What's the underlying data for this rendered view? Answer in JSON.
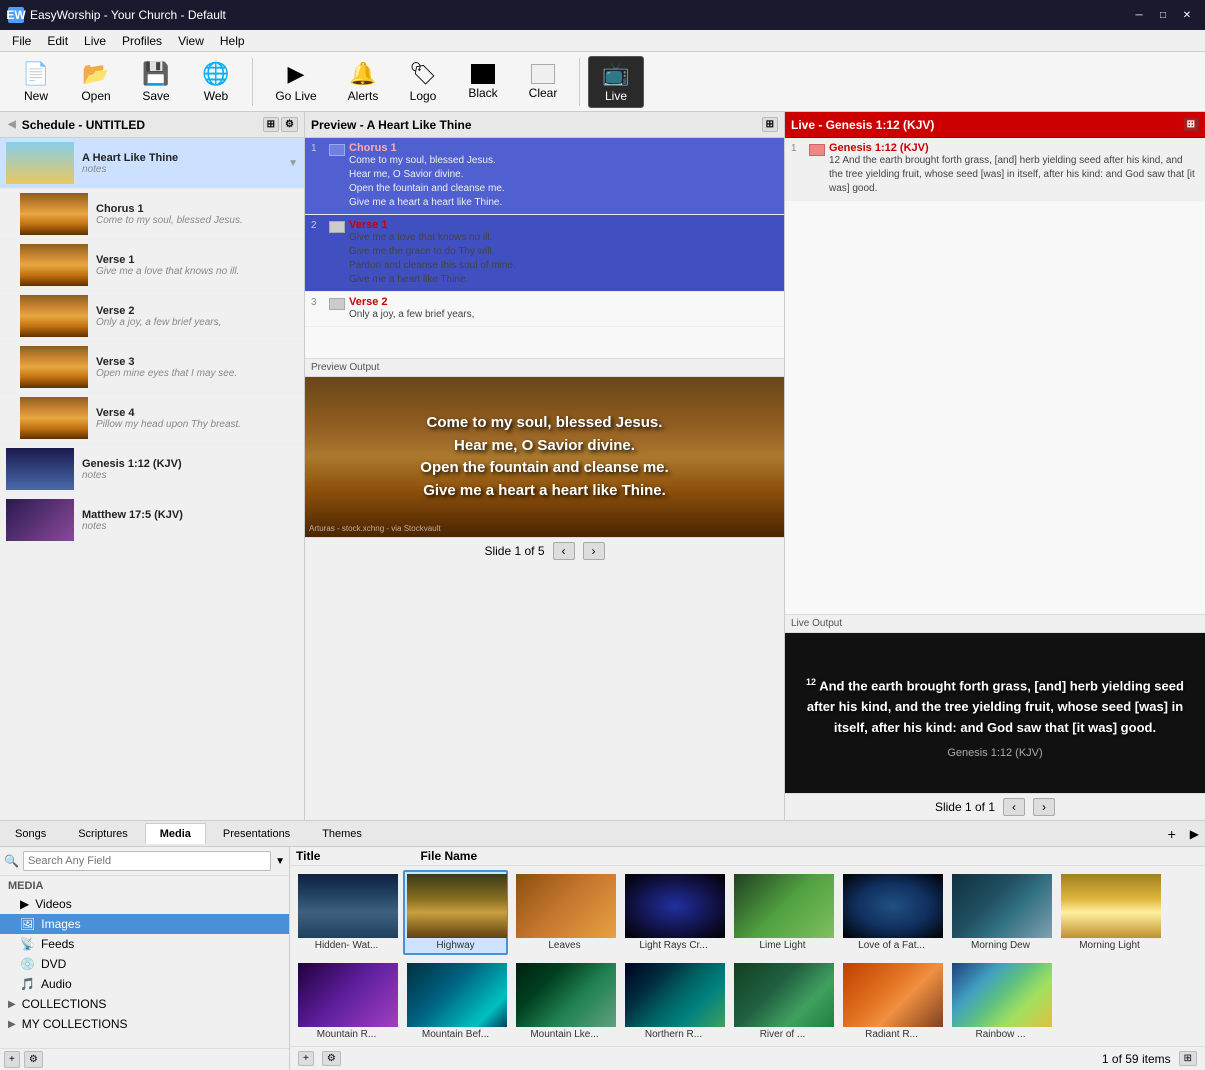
{
  "app": {
    "title": "EasyWorship - Your Church - Default",
    "icon": "EW"
  },
  "titlebar": {
    "minimize": "─",
    "maximize": "□",
    "close": "✕"
  },
  "menu": {
    "items": [
      "File",
      "Edit",
      "Live",
      "Profiles",
      "View",
      "Help"
    ]
  },
  "toolbar": {
    "new_label": "New",
    "open_label": "Open",
    "save_label": "Save",
    "web_label": "Web",
    "go_live_label": "Go Live",
    "alerts_label": "Alerts",
    "logo_label": "Logo",
    "black_label": "Black",
    "clear_label": "Clear",
    "live_label": "Live"
  },
  "schedule": {
    "title": "Schedule - UNTITLED",
    "items": [
      {
        "title": "A Heart Like Thine",
        "sub": "notes",
        "type": "active"
      },
      {
        "title": "Chorus 1",
        "sub": "Come to my soul, blessed Jesus.",
        "type": "song"
      },
      {
        "title": "Verse 1",
        "sub": "Give me a love that knows no ill.",
        "type": "song"
      },
      {
        "title": "Verse 2",
        "sub": "Only a joy, a few brief years,",
        "type": "song"
      },
      {
        "title": "Verse 3",
        "sub": "Open mine eyes that I may see.",
        "type": "song"
      },
      {
        "title": "Verse 4",
        "sub": "Pillow my head upon Thy breast.",
        "type": "song"
      },
      {
        "title": "Genesis 1:12 (KJV)",
        "sub": "notes",
        "type": "scripture"
      },
      {
        "title": "Matthew 17:5 (KJV)",
        "sub": "notes",
        "type": "scripture"
      }
    ]
  },
  "preview_panel": {
    "title": "Preview - A Heart Like Thine",
    "slides": [
      {
        "num": 1,
        "label": "Chorus 1",
        "lines": [
          "Come to my soul, blessed Jesus.",
          "Hear me, O Savior divine.",
          "Open the fountain and cleanse me.",
          "Give me a heart a heart like Thine."
        ]
      },
      {
        "num": 2,
        "label": "Verse 1",
        "lines": [
          "Give me a love that knows no ill.",
          "Give me the grace to do Thy will.",
          "Pardon and cleanse this soul of mine.",
          "Give me a heart like Thine."
        ]
      },
      {
        "num": 3,
        "label": "Verse 2",
        "lines": [
          "Only a joy, a few brief years,"
        ]
      }
    ],
    "output_label": "Preview Output",
    "preview_text": "Come to my soul, blessed Jesus.\nHear me, O Savior divine.\nOpen the fountain and cleanse me.\nGive me a heart a heart like Thine.",
    "preview_credit": "Arturas - stock.xchng - via Stockvault",
    "slide_nav": "Slide 1 of 5"
  },
  "live_panel": {
    "title": "Live - Genesis 1:12 (KJV)",
    "slide_label": "Genesis 1:12 (KJV)",
    "slide_text": "12 And the earth brought forth grass, [and] herb yielding seed after his kind, and the tree yielding fruit, whose seed [was] in itself, after his kind: and God saw that [it was] good.",
    "output_label": "Live Output",
    "live_text": "And the earth brought forth grass, [and] herb yielding seed after his kind, and the tree yielding fruit, whose seed [was] in itself, after his kind: and God saw that [it was] good.",
    "live_ref": "Genesis 1:12 (KJV)",
    "slide_nav": "Slide 1 of 1"
  },
  "tabs": {
    "items": [
      "Songs",
      "Scriptures",
      "Media",
      "Presentations",
      "Themes"
    ],
    "active": "Media"
  },
  "media": {
    "search_placeholder": "Search Any Field",
    "section_label": "MEDIA",
    "tree_items": [
      {
        "label": "Videos",
        "icon": "▶"
      },
      {
        "label": "Images",
        "icon": "🖼",
        "selected": true
      },
      {
        "label": "Feeds",
        "icon": "📡"
      },
      {
        "label": "DVD",
        "icon": "💿"
      },
      {
        "label": "Audio",
        "icon": "🎵"
      }
    ],
    "collections_label": "COLLECTIONS",
    "my_collections_label": "MY COLLECTIONS",
    "grid_title_col": "Title",
    "grid_filename_col": "File Name",
    "items": [
      {
        "label": "Hidden- Wat...",
        "type": "hidden"
      },
      {
        "label": "Highway",
        "type": "highway",
        "selected": true
      },
      {
        "label": "Leaves",
        "type": "leaves"
      },
      {
        "label": "Light Rays Cr...",
        "type": "light-rays"
      },
      {
        "label": "Lime Light",
        "type": "lime"
      },
      {
        "label": "Love of a Fat...",
        "type": "love"
      },
      {
        "label": "Morning Dew",
        "type": "morning-dew"
      },
      {
        "label": "Morning Light",
        "type": "morning-light"
      },
      {
        "label": "Mountain R...",
        "type": "mountain-r"
      },
      {
        "label": "Mountain Bef...",
        "type": "mountain-b"
      },
      {
        "label": "Mountain Lke...",
        "type": "mountain-l"
      },
      {
        "label": "Northern R...",
        "type": "northern"
      },
      {
        "label": "River of ...",
        "type": "river"
      },
      {
        "label": "Radiant R...",
        "type": "radiant"
      },
      {
        "label": "Rainbow ...",
        "type": "rainbow"
      }
    ],
    "status": "1 of 59 items"
  }
}
